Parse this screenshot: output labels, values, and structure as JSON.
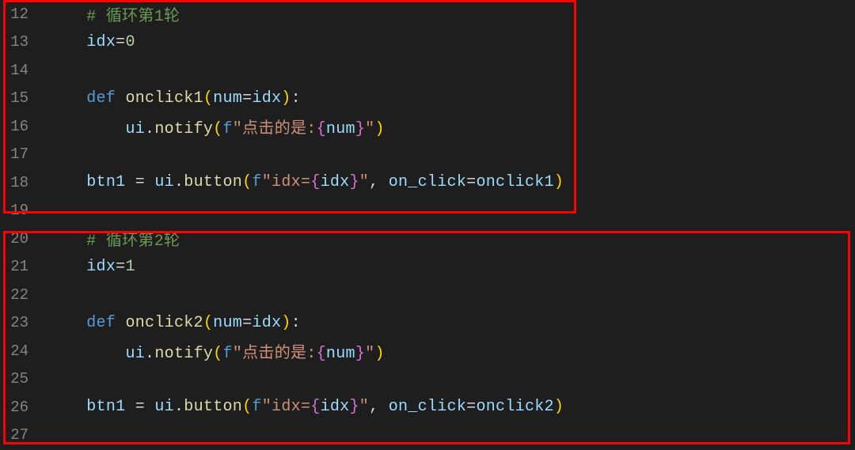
{
  "lines": [
    {
      "n": "12",
      "segs": [
        {
          "c": "tok-comment",
          "t": "# 循环第1轮"
        }
      ],
      "indent": 1
    },
    {
      "n": "13",
      "segs": [
        {
          "c": "tok-var",
          "t": "idx"
        },
        {
          "c": "tok-op",
          "t": "="
        },
        {
          "c": "tok-num",
          "t": "0"
        }
      ],
      "indent": 1
    },
    {
      "n": "14",
      "segs": [],
      "indent": 0
    },
    {
      "n": "15",
      "segs": [
        {
          "c": "tok-keyword-def",
          "t": "def"
        },
        {
          "c": "",
          "t": " "
        },
        {
          "c": "tok-fn",
          "t": "onclick1"
        },
        {
          "c": "tok-brace-yellow",
          "t": "("
        },
        {
          "c": "tok-param",
          "t": "num"
        },
        {
          "c": "tok-op",
          "t": "="
        },
        {
          "c": "tok-var",
          "t": "idx"
        },
        {
          "c": "tok-brace-yellow",
          "t": ")"
        },
        {
          "c": "tok-punct",
          "t": ":"
        }
      ],
      "indent": 1
    },
    {
      "n": "16",
      "segs": [
        {
          "c": "tok-var",
          "t": "ui"
        },
        {
          "c": "tok-punct",
          "t": "."
        },
        {
          "c": "tok-fn",
          "t": "notify"
        },
        {
          "c": "tok-brace-yellow",
          "t": "("
        },
        {
          "c": "tok-keyword",
          "t": "f"
        },
        {
          "c": "tok-str",
          "t": "\"点击的是:"
        },
        {
          "c": "tok-brace-pink",
          "t": "{"
        },
        {
          "c": "tok-var",
          "t": "num"
        },
        {
          "c": "tok-brace-pink",
          "t": "}"
        },
        {
          "c": "tok-str",
          "t": "\""
        },
        {
          "c": "tok-brace-yellow",
          "t": ")"
        }
      ],
      "indent": 2,
      "guide": true
    },
    {
      "n": "17",
      "segs": [],
      "indent": 0
    },
    {
      "n": "18",
      "segs": [
        {
          "c": "tok-var",
          "t": "btn1"
        },
        {
          "c": "",
          "t": " "
        },
        {
          "c": "tok-op",
          "t": "="
        },
        {
          "c": "",
          "t": " "
        },
        {
          "c": "tok-var",
          "t": "ui"
        },
        {
          "c": "tok-punct",
          "t": "."
        },
        {
          "c": "tok-fn",
          "t": "button"
        },
        {
          "c": "tok-brace-yellow",
          "t": "("
        },
        {
          "c": "tok-keyword",
          "t": "f"
        },
        {
          "c": "tok-str",
          "t": "\"idx="
        },
        {
          "c": "tok-brace-pink",
          "t": "{"
        },
        {
          "c": "tok-var",
          "t": "idx"
        },
        {
          "c": "tok-brace-pink",
          "t": "}"
        },
        {
          "c": "tok-str",
          "t": "\""
        },
        {
          "c": "tok-punct",
          "t": ", "
        },
        {
          "c": "tok-param",
          "t": "on_click"
        },
        {
          "c": "tok-op",
          "t": "="
        },
        {
          "c": "tok-var",
          "t": "onclick1"
        },
        {
          "c": "tok-brace-yellow",
          "t": ")"
        }
      ],
      "indent": 1
    },
    {
      "n": "19",
      "segs": [],
      "indent": 0
    },
    {
      "n": "20",
      "segs": [
        {
          "c": "tok-comment",
          "t": "# 循环第2轮"
        }
      ],
      "indent": 1
    },
    {
      "n": "21",
      "segs": [
        {
          "c": "tok-var",
          "t": "idx"
        },
        {
          "c": "tok-op",
          "t": "="
        },
        {
          "c": "tok-num",
          "t": "1"
        }
      ],
      "indent": 1
    },
    {
      "n": "22",
      "segs": [],
      "indent": 0
    },
    {
      "n": "23",
      "segs": [
        {
          "c": "tok-keyword-def",
          "t": "def"
        },
        {
          "c": "",
          "t": " "
        },
        {
          "c": "tok-fn",
          "t": "onclick2"
        },
        {
          "c": "tok-brace-yellow",
          "t": "("
        },
        {
          "c": "tok-param",
          "t": "num"
        },
        {
          "c": "tok-op",
          "t": "="
        },
        {
          "c": "tok-var",
          "t": "idx"
        },
        {
          "c": "tok-brace-yellow",
          "t": ")"
        },
        {
          "c": "tok-punct",
          "t": ":"
        }
      ],
      "indent": 1
    },
    {
      "n": "24",
      "segs": [
        {
          "c": "tok-var",
          "t": "ui"
        },
        {
          "c": "tok-punct",
          "t": "."
        },
        {
          "c": "tok-fn",
          "t": "notify"
        },
        {
          "c": "tok-brace-yellow",
          "t": "("
        },
        {
          "c": "tok-keyword",
          "t": "f"
        },
        {
          "c": "tok-str",
          "t": "\"点击的是:"
        },
        {
          "c": "tok-brace-pink",
          "t": "{"
        },
        {
          "c": "tok-var",
          "t": "num"
        },
        {
          "c": "tok-brace-pink",
          "t": "}"
        },
        {
          "c": "tok-str",
          "t": "\""
        },
        {
          "c": "tok-brace-yellow",
          "t": ")"
        }
      ],
      "indent": 2,
      "guide": true
    },
    {
      "n": "25",
      "segs": [],
      "indent": 0
    },
    {
      "n": "26",
      "segs": [
        {
          "c": "tok-var",
          "t": "btn1"
        },
        {
          "c": "",
          "t": " "
        },
        {
          "c": "tok-op",
          "t": "="
        },
        {
          "c": "",
          "t": " "
        },
        {
          "c": "tok-var",
          "t": "ui"
        },
        {
          "c": "tok-punct",
          "t": "."
        },
        {
          "c": "tok-fn",
          "t": "button"
        },
        {
          "c": "tok-brace-yellow",
          "t": "("
        },
        {
          "c": "tok-keyword",
          "t": "f"
        },
        {
          "c": "tok-str",
          "t": "\"idx="
        },
        {
          "c": "tok-brace-pink",
          "t": "{"
        },
        {
          "c": "tok-var",
          "t": "idx"
        },
        {
          "c": "tok-brace-pink",
          "t": "}"
        },
        {
          "c": "tok-str",
          "t": "\""
        },
        {
          "c": "tok-punct",
          "t": ", "
        },
        {
          "c": "tok-param",
          "t": "on_click"
        },
        {
          "c": "tok-op",
          "t": "="
        },
        {
          "c": "tok-var",
          "t": "onclick2"
        },
        {
          "c": "tok-brace-yellow",
          "t": ")"
        }
      ],
      "indent": 1
    },
    {
      "n": "27",
      "segs": [],
      "indent": 0
    }
  ],
  "indent_unit": "    "
}
